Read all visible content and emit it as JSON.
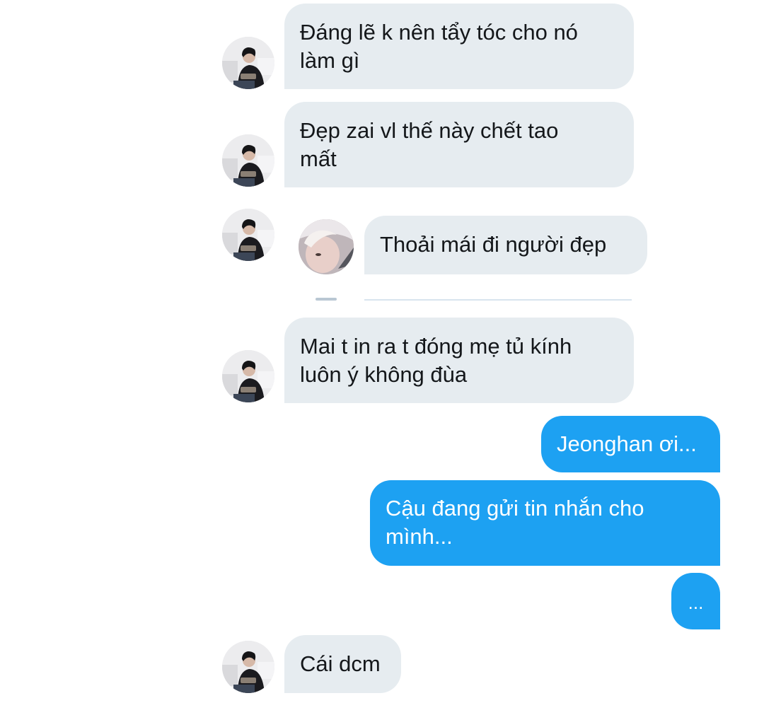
{
  "conversation": {
    "messages": [
      {
        "direction": "incoming",
        "text": "Đáng lẽ k nên tẩy tóc cho nó\nlàm gì"
      },
      {
        "direction": "incoming",
        "text": "Đẹp zai vl thế này chết tao\nmất"
      },
      {
        "direction": "incoming",
        "text": "Thoải mái đi người đẹp"
      },
      {
        "direction": "incoming",
        "text": "Mai t in ra t đóng mẹ tủ kính\nluôn ý không đùa"
      },
      {
        "direction": "outgoing",
        "text": "Jeonghan ơi..."
      },
      {
        "direction": "outgoing",
        "text": "Cậu đang gửi tin nhắn cho\nmình..."
      },
      {
        "direction": "outgoing",
        "text": "..."
      },
      {
        "direction": "incoming",
        "text": "Cái dcm"
      }
    ]
  },
  "colors": {
    "incoming_bubble": "#e6ecf0",
    "outgoing_bubble": "#1da1f2"
  },
  "icons": {
    "sender_avatar": "person-photo-avatar",
    "quoted_avatar": "person-photo-avatar"
  }
}
